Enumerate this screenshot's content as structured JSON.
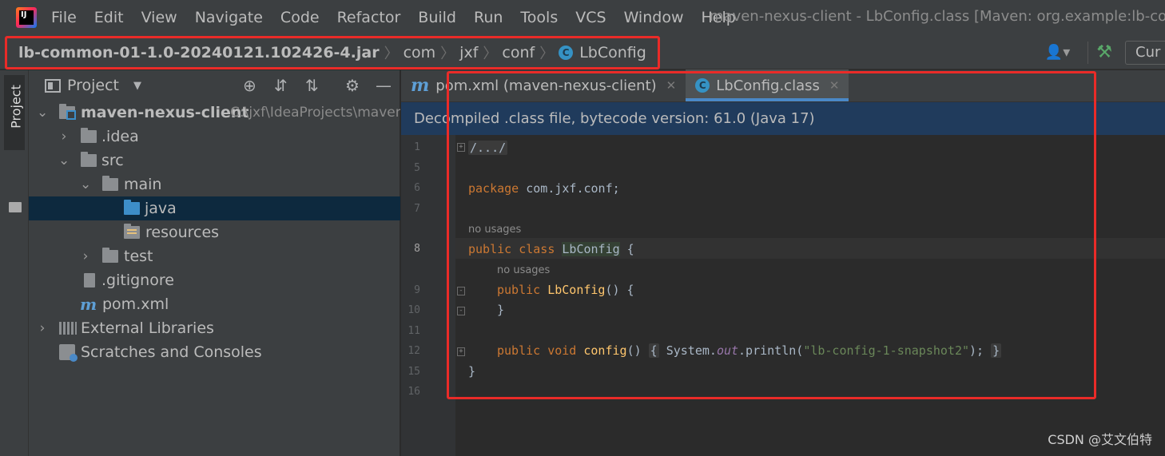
{
  "menu": {
    "items": [
      "File",
      "Edit",
      "View",
      "Navigate",
      "Code",
      "Refactor",
      "Build",
      "Run",
      "Tools",
      "VCS",
      "Window",
      "Help"
    ],
    "window_title": "maven-nexus-client - LbConfig.class [Maven: org.example:lb-comm"
  },
  "navbar": {
    "crumbs": [
      "lb-common-01-1.0-20240121.102426-4.jar",
      "com",
      "jxf",
      "conf",
      "LbConfig"
    ],
    "class_icon_letter": "C",
    "run_config_label": "Cur"
  },
  "side_stripe": {
    "project_label": "Project"
  },
  "project_panel": {
    "title": "Project",
    "tree": [
      {
        "label": "maven-nexus-client",
        "path": "C:\\jxf\\IdeaProjects\\maven"
      },
      {
        "label": ".idea"
      },
      {
        "label": "src"
      },
      {
        "label": "main"
      },
      {
        "label": "java"
      },
      {
        "label": "resources"
      },
      {
        "label": "test"
      },
      {
        "label": ".gitignore"
      },
      {
        "label": "pom.xml"
      },
      {
        "label": "External Libraries"
      },
      {
        "label": "Scratches and Consoles"
      }
    ]
  },
  "editor": {
    "tabs": [
      {
        "label": "pom.xml (maven-nexus-client)",
        "icon": "m"
      },
      {
        "label": "LbConfig.class",
        "icon": "C"
      }
    ],
    "banner": "Decompiled .class file, bytecode version: 61.0 (Java 17)",
    "line_numbers": [
      "1",
      "5",
      "6",
      "7",
      "8",
      "9",
      "10",
      "11",
      "12",
      "15",
      "16"
    ],
    "code": {
      "folded_header": "/.../",
      "package_kw": "package",
      "package_name": " com.jxf.conf;",
      "hint1": "no usages",
      "class_kw": "public class",
      "class_name": "LbConfig",
      "class_open": " {",
      "hint2": "no usages",
      "ctor_kw": "public",
      "ctor_name": "LbConfig",
      "ctor_rest": "() {",
      "ctor_close": "}",
      "method_kw": "public void",
      "method_name": "config",
      "method_parens": "()",
      "method_body_open": "{",
      "method_stmt_pre": "System.",
      "method_field": "out",
      "method_stmt_mid": ".println(",
      "method_string": "\"lb-config-1-snapshot2\"",
      "method_stmt_end": ");",
      "method_body_close": "}",
      "class_close": "}"
    }
  },
  "watermark": "CSDN @艾文伯特",
  "colors": {
    "highlight_border": "#ea2b28",
    "keyword": "#cc7832",
    "string": "#6a8759",
    "method": "#ffc66d",
    "selection": "#0d293e"
  }
}
